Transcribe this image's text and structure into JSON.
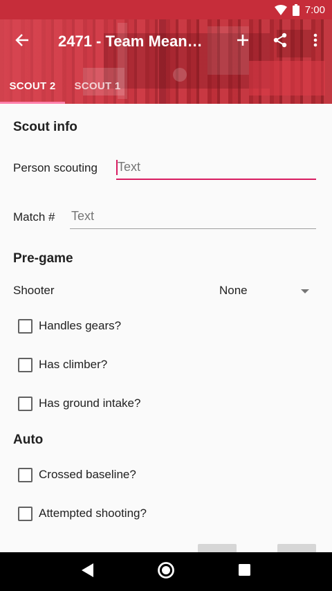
{
  "status_bar": {
    "time": "7:00",
    "icons": [
      "wifi-icon",
      "battery-icon"
    ]
  },
  "toolbar": {
    "title": "2471 - Team Mean…",
    "icons": [
      "back-arrow-icon",
      "add-icon",
      "share-icon",
      "more-vert-icon"
    ]
  },
  "tabs": [
    {
      "label": "SCOUT 2",
      "selected": true
    },
    {
      "label": "SCOUT 1",
      "selected": false
    }
  ],
  "scout_info": {
    "title": "Scout info",
    "person_label": "Person scouting",
    "person_placeholder": "Text",
    "match_label": "Match #",
    "match_placeholder": "Text"
  },
  "pregame": {
    "title": "Pre-game",
    "shooter_label": "Shooter",
    "shooter_value": "None",
    "checkboxes": [
      {
        "label": "Handles gears?",
        "checked": false
      },
      {
        "label": "Has climber?",
        "checked": false
      },
      {
        "label": "Has ground intake?",
        "checked": false
      }
    ]
  },
  "auto": {
    "title": "Auto",
    "checkboxes": [
      {
        "label": "Crossed baseline?",
        "checked": false
      },
      {
        "label": "Attempted shooting?",
        "checked": false
      }
    ]
  },
  "colors": {
    "primary": "#c62d3a",
    "accent": "#d81b60",
    "tab_indicator": "#ff80ab"
  },
  "nav_bar": {
    "icons": [
      "nav-back-icon",
      "nav-home-icon",
      "nav-recents-icon"
    ]
  }
}
